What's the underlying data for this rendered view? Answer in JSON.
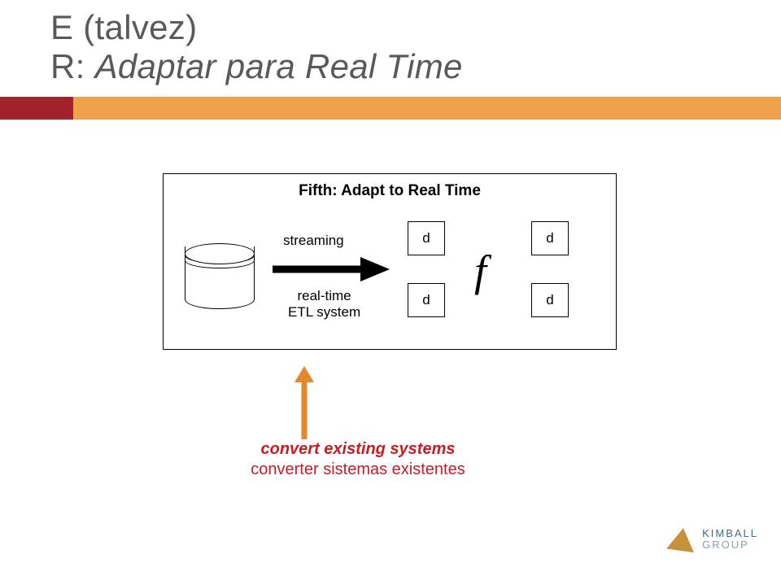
{
  "title": {
    "line1_prefix": "E ",
    "line1_paren": "(talvez)",
    "line2_prefix": "R: ",
    "line2_rest": "Adaptar para Real Time"
  },
  "diagram": {
    "frameTitle": "Fifth: Adapt to Real Time",
    "streamingLabel": "streaming",
    "etlLabel_line1": "real-time",
    "etlLabel_line2": "ETL system",
    "d": "d",
    "f": "f"
  },
  "callout": {
    "en": "convert existing systems",
    "pt": "converter sistemas existentes"
  },
  "logo": {
    "top": "KIMBALL",
    "bottom": "GROUP"
  }
}
